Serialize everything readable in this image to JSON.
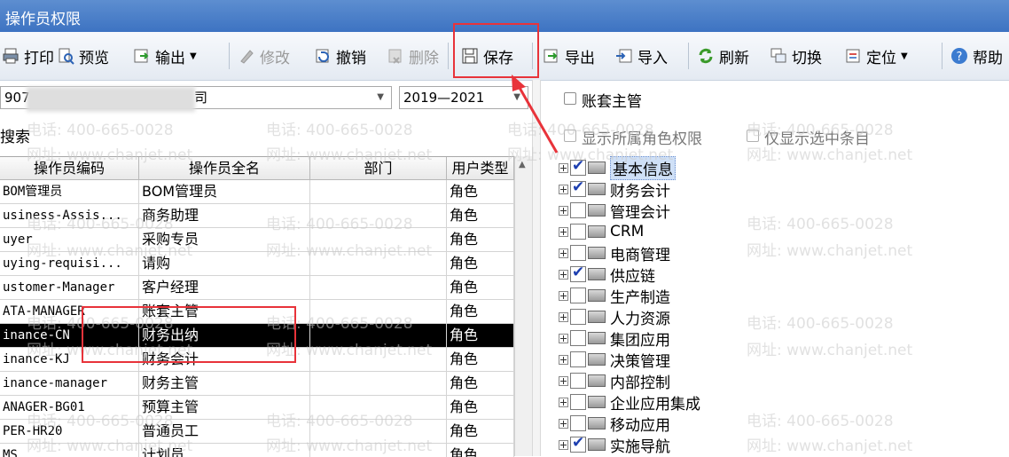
{
  "window": {
    "title": "操作员权限"
  },
  "toolbar": {
    "print": "打印",
    "preview": "预览",
    "output": "输出",
    "modify": "修改",
    "undo": "撤销",
    "delete": "删除",
    "save": "保存",
    "export": "导出",
    "import": "导入",
    "refresh": "刷新",
    "switch": "切换",
    "locate": "定位",
    "help": "帮助"
  },
  "filters": {
    "account_prefix": "907",
    "account_suffix": "司",
    "year_range": "2019—2021",
    "search_label": "搜索",
    "account_manager_label": "账套主管",
    "show_role_rights_label": "显示所属角色权限",
    "show_selected_only_label": "仅显示选中条目"
  },
  "table": {
    "columns": [
      "操作员编码",
      "操作员全名",
      "部门",
      "用户类型"
    ],
    "rows": [
      {
        "code": "BOM管理员",
        "name": "BOM管理员",
        "dept": "",
        "type": "角色"
      },
      {
        "code": "usiness-Assis...",
        "name": "商务助理",
        "dept": "",
        "type": "角色"
      },
      {
        "code": "uyer",
        "name": "采购专员",
        "dept": "",
        "type": "角色"
      },
      {
        "code": "uying-requisi...",
        "name": "请购",
        "dept": "",
        "type": "角色"
      },
      {
        "code": "ustomer-Manager",
        "name": "客户经理",
        "dept": "",
        "type": "角色"
      },
      {
        "code": "ATA-MANAGER",
        "name": "账套主管",
        "dept": "",
        "type": "角色"
      },
      {
        "code": "inance-CN",
        "name": "财务出纳",
        "dept": "",
        "type": "角色"
      },
      {
        "code": "inance-KJ",
        "name": "财务会计",
        "dept": "",
        "type": "角色"
      },
      {
        "code": "inance-manager",
        "name": "财务主管",
        "dept": "",
        "type": "角色"
      },
      {
        "code": "ANAGER-BG01",
        "name": "预算主管",
        "dept": "",
        "type": "角色"
      },
      {
        "code": "PER-HR20",
        "name": "普通员工",
        "dept": "",
        "type": "角色"
      },
      {
        "code": "MS",
        "name": "计划员",
        "dept": "",
        "type": "角色"
      }
    ],
    "selected_index": 6
  },
  "tree": [
    {
      "label": "基本信息",
      "checked": true
    },
    {
      "label": "财务会计",
      "checked": true
    },
    {
      "label": "管理会计",
      "checked": false
    },
    {
      "label": "CRM",
      "checked": false
    },
    {
      "label": "电商管理",
      "checked": false
    },
    {
      "label": "供应链",
      "checked": true
    },
    {
      "label": "生产制造",
      "checked": false
    },
    {
      "label": "人力资源",
      "checked": false
    },
    {
      "label": "集团应用",
      "checked": false
    },
    {
      "label": "决策管理",
      "checked": false
    },
    {
      "label": "内部控制",
      "checked": false
    },
    {
      "label": "企业应用集成",
      "checked": false
    },
    {
      "label": "移动应用",
      "checked": false
    },
    {
      "label": "实施导航",
      "checked": true
    }
  ],
  "watermark": {
    "phone": "电话: 400-665-0028",
    "site": "网址: www.chanjet.net"
  },
  "colors": {
    "titlebar": "#4a7fca",
    "highlight_box": "#e8333a",
    "selected_row": "#000000"
  }
}
